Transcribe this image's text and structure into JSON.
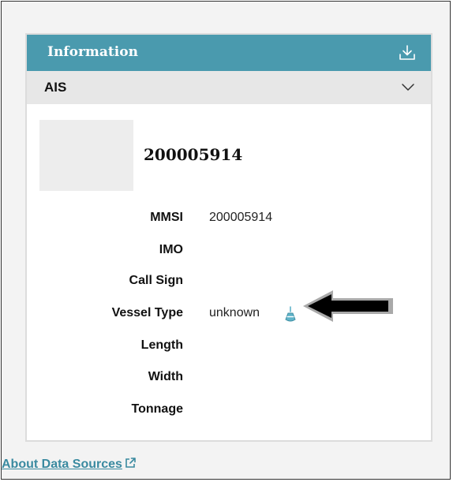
{
  "panel": {
    "header": {
      "title": "Information",
      "download_icon": "download-icon"
    },
    "section": {
      "title": "AIS",
      "chevron_icon": "chevron-down-icon"
    },
    "vessel": {
      "name": "200005914"
    },
    "details": [
      {
        "label": "MMSI",
        "value": "200005914"
      },
      {
        "label": "IMO",
        "value": ""
      },
      {
        "label": "Call Sign",
        "value": ""
      },
      {
        "label": "Vessel Type",
        "value": "unknown"
      },
      {
        "label": "Length",
        "value": ""
      },
      {
        "label": "Width",
        "value": ""
      },
      {
        "label": "Tonnage",
        "value": ""
      }
    ],
    "vessel_type_icon": "buoy-icon"
  },
  "footer": {
    "link_label": "About Data Sources",
    "link_icon": "external-link-icon"
  },
  "colors": {
    "header_bg": "#4a9aae",
    "section_bg": "#e7e7e7",
    "link": "#3a8aa0",
    "icon_accent": "#5fb3c9"
  }
}
